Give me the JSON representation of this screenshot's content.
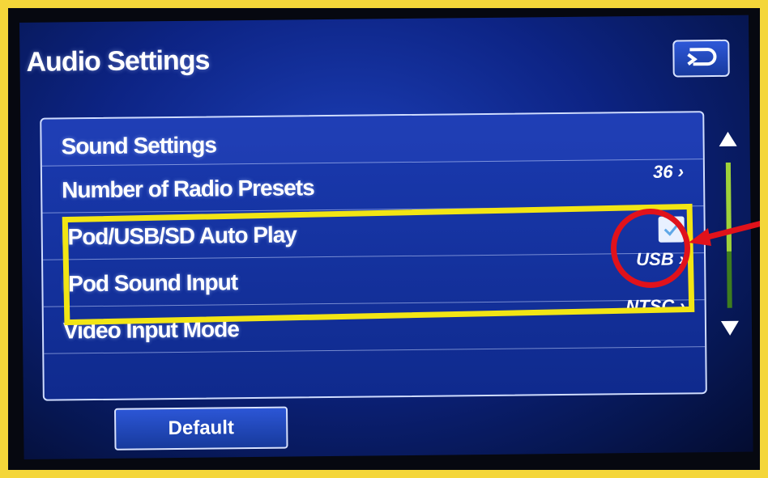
{
  "header": {
    "title": "Audio Settings",
    "back_icon": "back-return-icon"
  },
  "list": {
    "heading": "Sound Settings",
    "items": [
      {
        "label": "Number of Radio Presets",
        "value": "36"
      },
      {
        "label": "iPod/USB/SD Auto Play",
        "checked": true
      },
      {
        "label": "iPod Sound Input",
        "value": "USB"
      },
      {
        "label": "Video Input Mode",
        "value": "NTSC"
      }
    ]
  },
  "footer": {
    "default_label": "Default"
  },
  "colors": {
    "screen_blue": "#0d2485",
    "highlight_yellow": "#f2e514",
    "annotation_red": "#e0121b",
    "scroll_green": "#9fd23a"
  }
}
